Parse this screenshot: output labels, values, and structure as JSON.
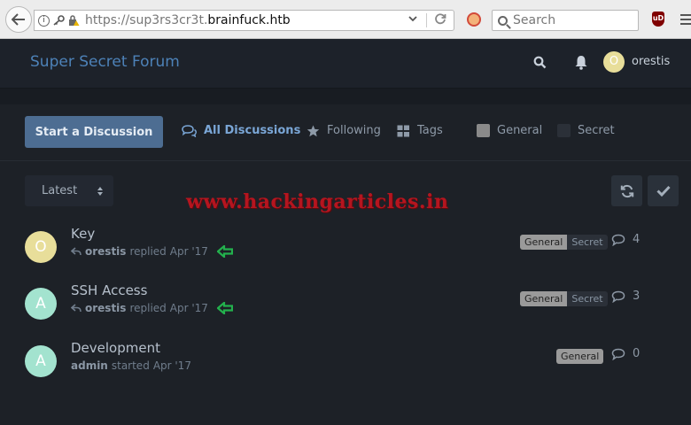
{
  "browser": {
    "url_prefix": "https://sup3rs3cr3t.",
    "url_host": "brainfuck.htb",
    "search_placeholder": "Search",
    "ublock_label": "uD"
  },
  "forum": {
    "title": "Super Secret Forum",
    "user": {
      "avatar_letter": "O",
      "name": "orestis",
      "avatar_color": "#e8de9a"
    }
  },
  "toolbar": {
    "start_button": "Start a Discussion",
    "nav": [
      {
        "label": "All Discussions",
        "icon": "comments-icon",
        "active": true
      },
      {
        "label": "Following",
        "icon": "star-icon"
      },
      {
        "label": "Tags",
        "icon": "grid-icon"
      }
    ],
    "tags": [
      {
        "label": "General",
        "color": "#8a8a8a"
      },
      {
        "label": "Secret",
        "color": "#2b3038"
      }
    ]
  },
  "sort": {
    "label": "Latest"
  },
  "discussions": [
    {
      "avatar_letter": "O",
      "avatar_color": "#e8de9a",
      "title": "Key",
      "user": "orestis",
      "action": "replied",
      "date": "Apr '17",
      "tags": [
        "General",
        "Secret"
      ],
      "replies": "4",
      "has_arrow": true
    },
    {
      "avatar_letter": "A",
      "avatar_color": "#a3e3cf",
      "title": "SSH Access",
      "user": "orestis",
      "action": "replied",
      "date": "Apr '17",
      "tags": [
        "General",
        "Secret"
      ],
      "replies": "3",
      "has_arrow": true
    },
    {
      "avatar_letter": "A",
      "avatar_color": "#a3e3cf",
      "title": "Development",
      "user": "admin",
      "action": "started",
      "date": "Apr '17",
      "tags": [
        "General"
      ],
      "replies": "0",
      "has_arrow": false
    }
  ],
  "watermark": "www.hackingarticles.in"
}
